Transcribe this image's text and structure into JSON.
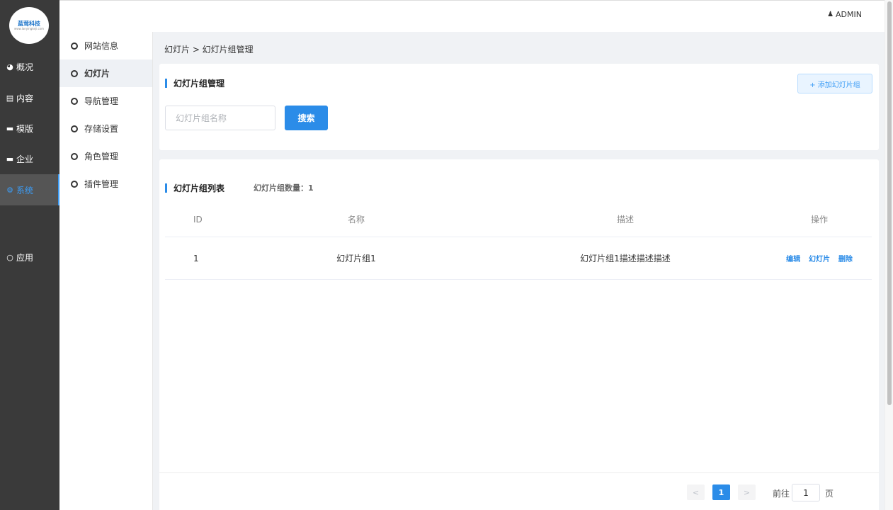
{
  "logo": {
    "text": "蓝莺科技",
    "subtext": "www.lanyingkeji.com"
  },
  "rail": {
    "items": [
      {
        "label": "概况",
        "icon": "dashboard-icon"
      },
      {
        "label": "内容",
        "icon": "document-icon"
      },
      {
        "label": "模版",
        "icon": "template-icon"
      },
      {
        "label": "企业",
        "icon": "enterprise-icon"
      },
      {
        "label": "系统",
        "icon": "gears-icon",
        "active": true
      },
      {
        "label": "应用",
        "icon": "circle-icon"
      }
    ]
  },
  "topbar": {
    "user": "ADMIN"
  },
  "submenu": {
    "items": [
      {
        "label": "网站信息"
      },
      {
        "label": "幻灯片",
        "active": true
      },
      {
        "label": "导航管理"
      },
      {
        "label": "存储设置"
      },
      {
        "label": "角色管理"
      },
      {
        "label": "插件管理"
      }
    ]
  },
  "breadcrumb": "幻灯片 > 幻灯片组管理",
  "manage": {
    "title": "幻灯片组管理",
    "add_label": "+ 添加幻灯片组",
    "search_placeholder": "幻灯片组名称",
    "search_label": "搜索"
  },
  "list": {
    "title": "幻灯片组列表",
    "count_text": "幻灯片组数量：1",
    "headers": {
      "id": "ID",
      "name": "名称",
      "desc": "描述",
      "ops": "操作"
    },
    "rows": [
      {
        "id": "1",
        "name": "幻灯片组1",
        "desc": "幻灯片组1描述描述描述",
        "ops": [
          "编辑",
          "幻灯片",
          "删除"
        ]
      }
    ]
  },
  "pagination": {
    "prev": "<",
    "next": ">",
    "current": "1",
    "goto_label": "前往",
    "goto_value": "1",
    "page_label": "页"
  },
  "colors": {
    "accent": "#2b8ce8",
    "rail_bg": "#3a3a3a"
  }
}
